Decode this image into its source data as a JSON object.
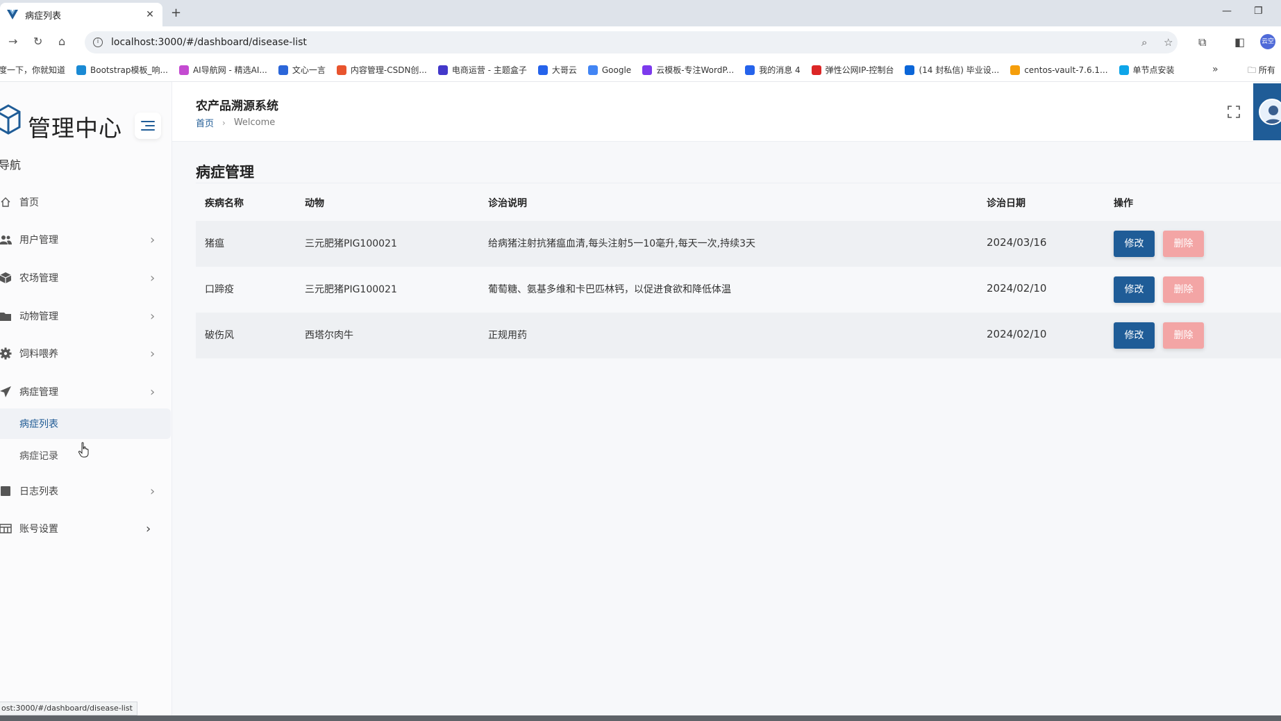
{
  "browser": {
    "tab_title": "病症列表",
    "url": "localhost:3000/#/dashboard/disease-list",
    "bookmarks": [
      {
        "label": "百度一下，你就知道",
        "color": "#2b66d9"
      },
      {
        "label": "Bootstrap模板_响...",
        "color": "#1a8ad4"
      },
      {
        "label": "AI导航网 - 精选AI...",
        "color": "#c44bd1"
      },
      {
        "label": "文心一言",
        "color": "#2b66d9"
      },
      {
        "label": "内容管理-CSDN创...",
        "color": "#e8542e"
      },
      {
        "label": "电商运营 - 主题盒子",
        "color": "#4338ca"
      },
      {
        "label": "大哥云",
        "color": "#2563eb"
      },
      {
        "label": "Google",
        "color": "#4285f4"
      },
      {
        "label": "云模板-专注WordP...",
        "color": "#7c3aed"
      },
      {
        "label": "我的消息 4",
        "color": "#2563eb"
      },
      {
        "label": "弹性公网IP-控制台",
        "color": "#dc2626"
      },
      {
        "label": "(14 封私信) 毕业设...",
        "color": "#0b66d8"
      },
      {
        "label": "centos-vault-7.6.1...",
        "color": "#f59e0b"
      },
      {
        "label": "单节点安装",
        "color": "#0ea5e9"
      }
    ],
    "bookmarks_folder": "所有",
    "profile_initials": "云空",
    "status_url": "ost:3000/#/dashboard/disease-list"
  },
  "sidebar": {
    "logo_text": "管理中心",
    "nav_header": "导航",
    "items": [
      {
        "label": "首页",
        "icon": "home-icon",
        "has_children": false
      },
      {
        "label": "用户管理",
        "icon": "users-icon",
        "has_children": true
      },
      {
        "label": "农场管理",
        "icon": "cube-icon",
        "has_children": true
      },
      {
        "label": "动物管理",
        "icon": "folder-icon",
        "has_children": true
      },
      {
        "label": "饲料喂养",
        "icon": "gear-icon",
        "has_children": true
      },
      {
        "label": "病症管理",
        "icon": "send-icon",
        "has_children": true
      },
      {
        "label": "日志列表",
        "icon": "square-icon",
        "has_children": true
      },
      {
        "label": "账号设置",
        "icon": "table-icon",
        "has_children": true
      }
    ],
    "sub_items": [
      {
        "label": "病症列表",
        "active": true
      },
      {
        "label": "病症记录",
        "active": false
      }
    ]
  },
  "header": {
    "app_title": "农产品溯源系统",
    "breadcrumb_home": "首页",
    "breadcrumb_current": "Welcome"
  },
  "main": {
    "page_title": "病症管理",
    "columns": [
      "疾病名称",
      "动物",
      "诊治说明",
      "诊治日期",
      "操作"
    ],
    "rows": [
      {
        "name": "猪瘟",
        "animal": "三元肥猪PIG100021",
        "note": "给病猪注射抗猪瘟血清,每头注射5一10毫升,每天一次,持续3天",
        "date": "2024/03/16"
      },
      {
        "name": "口蹄疫",
        "animal": "三元肥猪PIG100021",
        "note": "葡萄糖、氨基多维和卡巴匹林钙，以促进食欲和降低体温",
        "date": "2024/02/10"
      },
      {
        "name": "破伤风",
        "animal": "西塔尔肉牛",
        "note": "正规用药",
        "date": "2024/02/10"
      }
    ],
    "edit_label": "修改",
    "delete_label": "删除"
  },
  "colors": {
    "primary": "#1f5c97",
    "danger_light": "#f3a5a5",
    "row_stripe": "#eef0f3"
  }
}
